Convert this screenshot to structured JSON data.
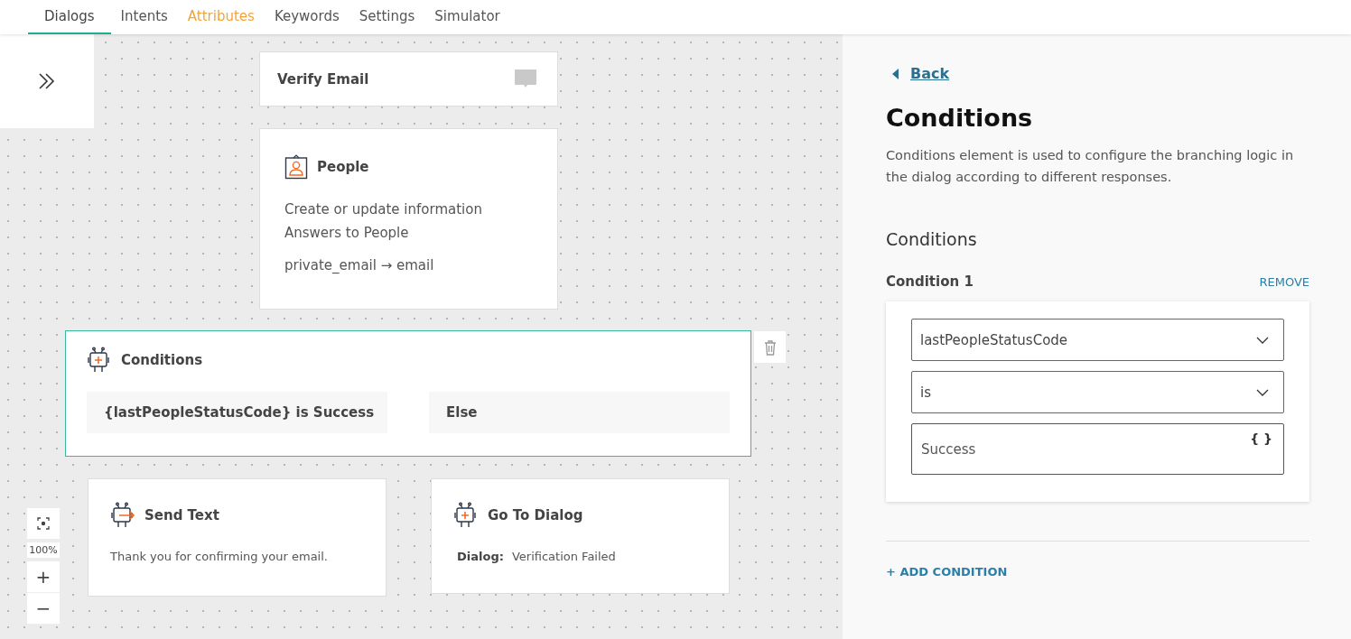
{
  "tabs": [
    {
      "label": "Dialogs",
      "selected": true,
      "highlighted": false
    },
    {
      "label": "Intents",
      "selected": false,
      "highlighted": false
    },
    {
      "label": "Attributes",
      "selected": false,
      "highlighted": true
    },
    {
      "label": "Keywords",
      "selected": false,
      "highlighted": false
    },
    {
      "label": "Settings",
      "selected": false,
      "highlighted": false
    },
    {
      "label": "Simulator",
      "selected": false,
      "highlighted": false
    }
  ],
  "canvas": {
    "zoom_label": "100%",
    "zoom_in": "+",
    "zoom_out": "−",
    "nodes": [
      {
        "kind": "start",
        "title": "Verify Email"
      },
      {
        "kind": "people",
        "title": "People",
        "lines": [
          "Create or update information",
          "Answers to People"
        ],
        "mapping": "private_email → email"
      },
      {
        "kind": "conditions",
        "title": "Conditions",
        "selected": true,
        "branches": [
          "{lastPeopleStatusCode} is Success",
          "Else"
        ]
      },
      {
        "kind": "send_text",
        "title": "Send Text",
        "text": "Thank you for confirming your email."
      },
      {
        "kind": "go_to",
        "title": "Go To Dialog",
        "label": "Dialog:",
        "value": "Verification Failed"
      }
    ]
  },
  "panel": {
    "back": "Back",
    "title": "Conditions",
    "description": "Conditions element is used to configure the branching logic in the dialog according to different responses.",
    "section": "Conditions",
    "conditions": [
      {
        "label": "Condition 1",
        "remove": "REMOVE",
        "attribute": "lastPeopleStatusCode",
        "operator": "is",
        "value": "Success",
        "value_icon": "{ }"
      }
    ],
    "add": "+ ADD CONDITION"
  }
}
